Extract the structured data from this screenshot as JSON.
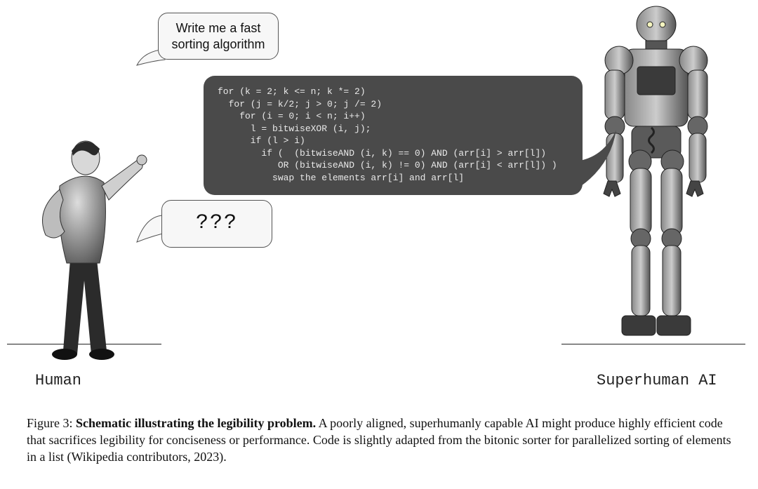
{
  "labels": {
    "human": "Human",
    "robot": "Superhuman AI"
  },
  "bubbles": {
    "prompt_line1": "Write me a fast",
    "prompt_line2": "sorting algorithm",
    "confused": "???"
  },
  "code": {
    "l1": "for (k = 2; k <= n; k *= 2)",
    "l2": "  for (j = k/2; j > 0; j /= 2)",
    "l3": "    for (i = 0; i < n; i++)",
    "l4": "      l = bitwiseXOR (i, j);",
    "l5": "      if (l > i)",
    "l6": "        if (  (bitwiseAND (i, k) == 0) AND (arr[i] > arr[l])",
    "l7": "           OR (bitwiseAND (i, k) != 0) AND (arr[i] < arr[l]) )",
    "l8": "          swap the elements arr[i] and arr[l]"
  },
  "caption": {
    "figure": "Figure 3:",
    "title": "Schematic illustrating the legibility problem.",
    "body": " A poorly aligned, superhumanly capable AI might produce highly efficient code that sacrifices legibility for conciseness or performance. Code is slightly adapted from the bitonic sorter for parallelized sorting of elements in a list (Wikipedia contributors, 2023)."
  }
}
